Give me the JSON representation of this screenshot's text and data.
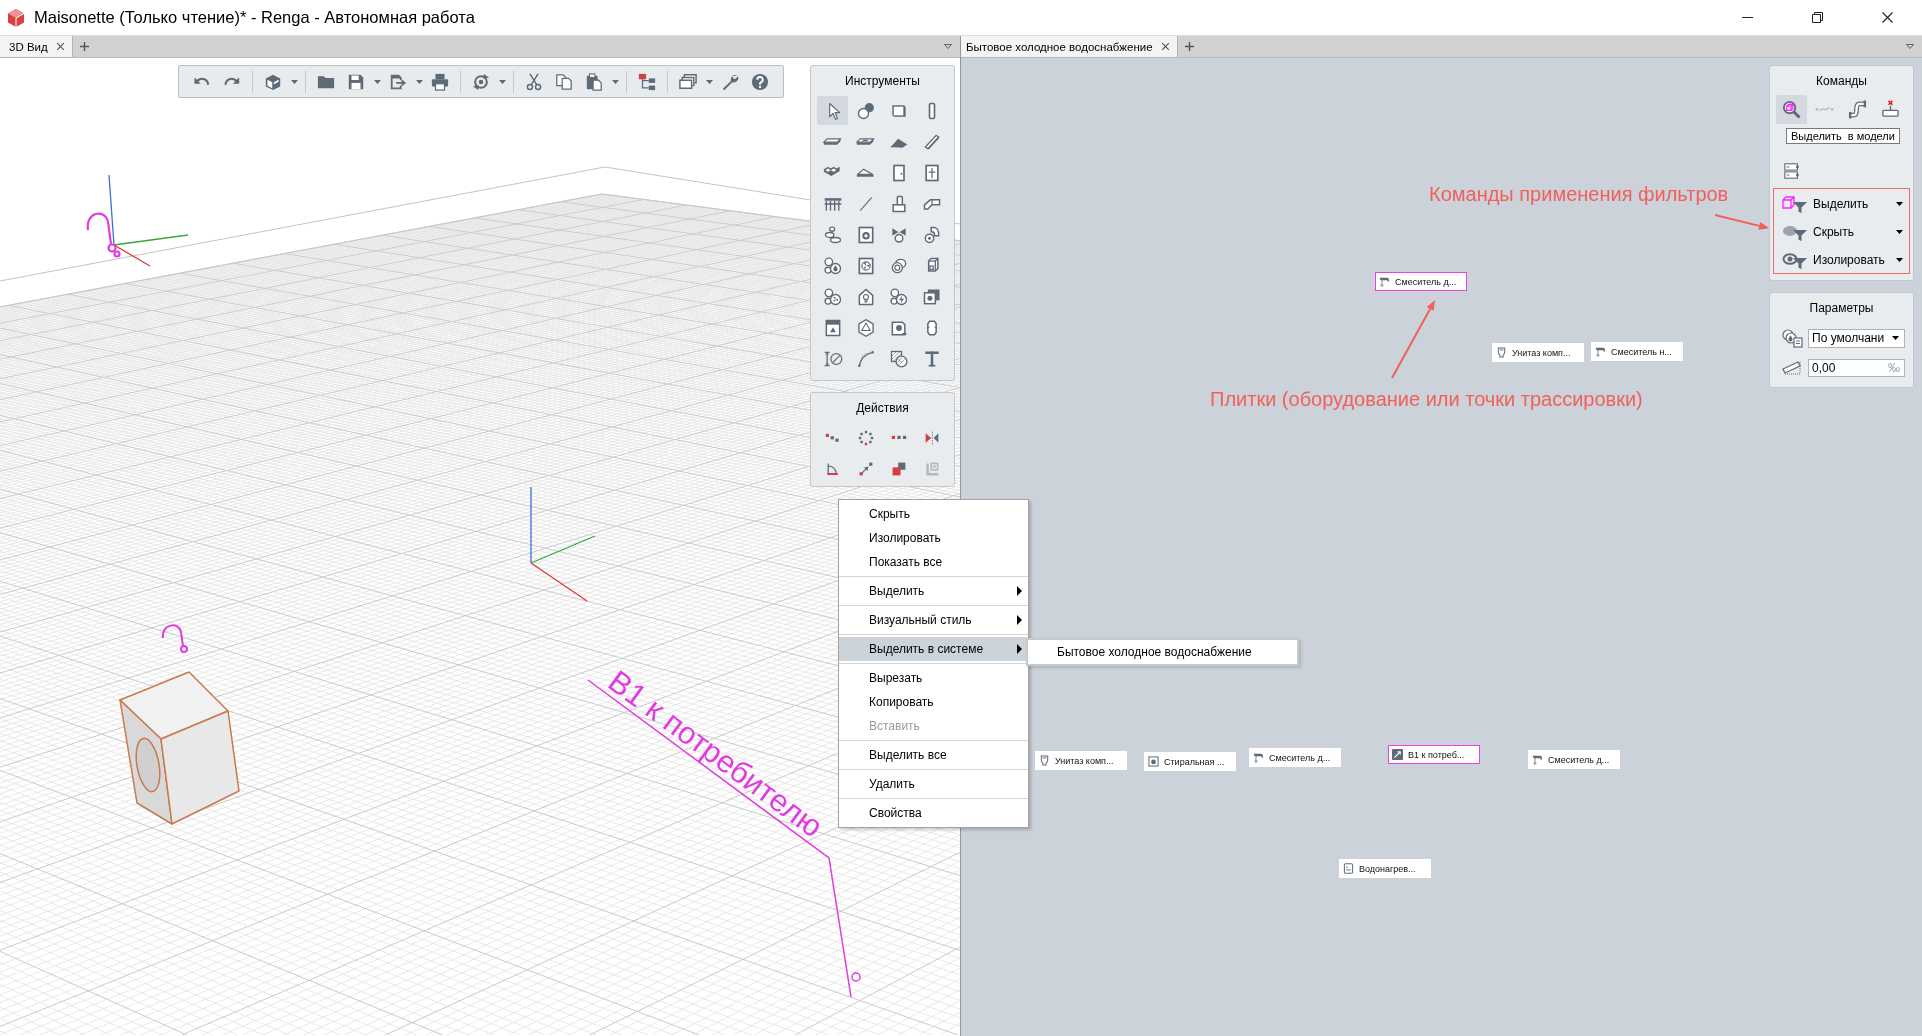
{
  "window": {
    "title": "Maisonette (Только чтение)* - Renga - Автономная работа"
  },
  "left_pane": {
    "tabs": [
      {
        "label": "3D Вид",
        "selected": true
      }
    ],
    "tools_panel": {
      "title": "Инструменты",
      "tools": [
        {
          "selected": true
        },
        {
          "selected": false
        },
        {
          "selected": false
        },
        {
          "selected": false
        },
        {
          "selected": false
        },
        {
          "selected": false
        },
        {
          "selected": false
        },
        {
          "selected": false
        },
        {
          "selected": false
        },
        {
          "selected": false
        },
        {
          "selected": false
        },
        {
          "selected": false
        },
        {
          "selected": false
        },
        {
          "selected": false
        },
        {
          "selected": false
        },
        {
          "selected": false
        },
        {
          "selected": false
        },
        {
          "selected": false
        },
        {
          "selected": false
        },
        {
          "selected": false
        },
        {
          "selected": false
        },
        {
          "selected": false
        },
        {
          "selected": false
        },
        {
          "selected": false
        },
        {
          "selected": false
        },
        {
          "selected": false
        },
        {
          "selected": false
        },
        {
          "selected": false
        },
        {
          "selected": false
        },
        {
          "selected": false
        },
        {
          "selected": false
        },
        {
          "selected": false
        },
        {
          "selected": false
        },
        {
          "selected": false
        },
        {
          "selected": false
        },
        {
          "selected": false
        }
      ]
    },
    "actions_panel": {
      "title": "Действия",
      "actions": [
        {
          "disabled": false
        },
        {
          "disabled": false
        },
        {
          "disabled": false
        },
        {
          "disabled": false
        },
        {
          "disabled": false
        },
        {
          "disabled": false
        },
        {
          "disabled": false
        },
        {
          "disabled": true
        }
      ]
    },
    "viewport": {
      "pipe_label": "В1 к потребителю"
    }
  },
  "context_menu": {
    "groups": [
      {
        "items": [
          {
            "label": "Скрыть",
            "kind": "command",
            "disabled": false,
            "selected": false
          },
          {
            "label": "Изолировать",
            "kind": "command",
            "disabled": false,
            "selected": false
          },
          {
            "label": "Показать все",
            "kind": "command",
            "disabled": false,
            "selected": false
          }
        ]
      },
      {
        "items": [
          {
            "label": "Выделить",
            "kind": "submenu",
            "disabled": false,
            "selected": false
          }
        ]
      },
      {
        "items": [
          {
            "label": "Визуальный стиль",
            "kind": "submenu",
            "disabled": false,
            "selected": false
          }
        ]
      },
      {
        "items": [
          {
            "label": "Выделить в системе",
            "kind": "submenu",
            "disabled": false,
            "selected": true
          }
        ]
      },
      {
        "items": [
          {
            "label": "Вырезать",
            "kind": "command",
            "disabled": false,
            "selected": false
          },
          {
            "label": "Копировать",
            "kind": "command",
            "disabled": false,
            "selected": false
          },
          {
            "label": "Вставить",
            "kind": "command",
            "disabled": true,
            "selected": false
          }
        ]
      },
      {
        "items": [
          {
            "label": "Выделить все",
            "kind": "command",
            "disabled": false,
            "selected": false
          }
        ]
      },
      {
        "items": [
          {
            "label": "Удалить",
            "kind": "command",
            "disabled": false,
            "selected": false
          }
        ]
      },
      {
        "items": [
          {
            "label": "Свойства",
            "kind": "command",
            "disabled": false,
            "selected": false
          }
        ]
      }
    ]
  },
  "submenu": {
    "items": [
      {
        "label": "Бытовое холодное водоснабжение"
      }
    ]
  },
  "right_pane": {
    "tabs": [
      {
        "label": "Бытовое холодное водоснабжение",
        "selected": true
      }
    ],
    "tiles": [
      {
        "label": "Смеситель д...",
        "kind": "faucet",
        "selected": true
      },
      {
        "label": "Унитаз комп...",
        "kind": "toilet",
        "selected": false
      },
      {
        "label": "Смеситель н...",
        "kind": "faucet",
        "selected": false
      },
      {
        "label": "Унитаз комп...",
        "kind": "toilet",
        "selected": false
      },
      {
        "label": "Стиральная ...",
        "kind": "washer",
        "selected": false
      },
      {
        "label": "Смеситель д...",
        "kind": "faucet",
        "selected": false
      },
      {
        "label": "В1 к потреб...",
        "kind": "route_point",
        "selected": true
      },
      {
        "label": "Смеситель д...",
        "kind": "faucet",
        "selected": false
      },
      {
        "label": "Водонагрев...",
        "kind": "heater",
        "selected": false
      }
    ],
    "annotations": [
      {
        "text": "Команды применения фильтров"
      },
      {
        "text": "Плитки (оборудование или точки трассировки)"
      }
    ],
    "commands_panel": {
      "title": "Команды",
      "buttons": [
        {
          "selected": true,
          "disabled": false
        },
        {
          "selected": false,
          "disabled": true
        },
        {
          "selected": false,
          "disabled": false
        },
        {
          "selected": false,
          "disabled": false
        }
      ],
      "tooltip": "Выделить  в модели",
      "filters": [
        {
          "label": "Выделить"
        },
        {
          "label": "Скрыть"
        },
        {
          "label": "Изолировать"
        }
      ]
    },
    "parameters_panel": {
      "title": "Параметры",
      "style_select": {
        "value": "По умолчани"
      },
      "slope_field": {
        "value": "0,00",
        "unit": "‰"
      }
    }
  }
}
